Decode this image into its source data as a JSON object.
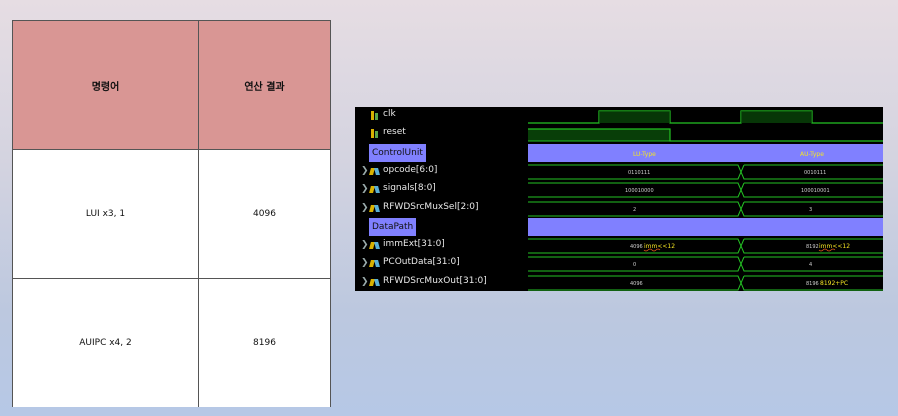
{
  "table": {
    "headers": [
      "명령어",
      "연산 결과"
    ],
    "rows": [
      {
        "instruction": "LUI x3, 1",
        "result": "4096"
      },
      {
        "instruction": "AUIPC x4, 2",
        "result": "8196"
      }
    ]
  },
  "waveform": {
    "signals": {
      "clk": "clk",
      "reset": "reset",
      "control_group": "ControlUnit",
      "opcode": "opcode[6:0]",
      "signals": "signals[8:0]",
      "rfwd_sel": "RFWDSrcMuxSel[2:0]",
      "datapath_group": "DataPath",
      "immext": "immExt[31:0]",
      "pcout": "PCOutData[31:0]",
      "rfwd_out": "RFWDSrcMuxOut[31:0]"
    },
    "annotations": {
      "control_lu": "LU-Type",
      "control_au": "AU-Type",
      "opcode_1": "0110111",
      "opcode_2": "0010111",
      "signals_1": "100010000",
      "signals_2": "100010001",
      "rfwd_sel_1": "2",
      "rfwd_sel_2": "3",
      "immext_1": "4096",
      "immext_2": "8192",
      "immext_note_1": "imm<<12",
      "immext_note_2": "imm<<12",
      "pcout_1": "0",
      "pcout_2": "4",
      "rfwd_out_1": "4096",
      "rfwd_out_2": "8196",
      "rfwd_out_note_2": "8192+PC"
    },
    "colors": {
      "signal_green": "#23c223",
      "group_bar": "#8080ff",
      "note_yellow": "#f5e623"
    }
  }
}
